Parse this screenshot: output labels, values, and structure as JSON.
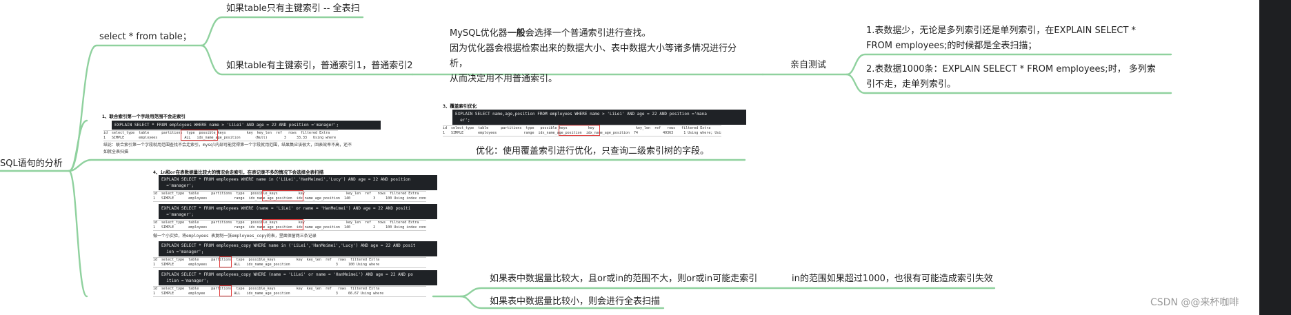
{
  "root": {
    "label": "SQL语句的分析"
  },
  "branch_select": {
    "label": "select * from table；",
    "children": [
      "如果table只有主键索引 -- 全表扫",
      "如果table有主键索引，普通索引1，普通索引2"
    ]
  },
  "optimizer": {
    "line1_prefix": "MySQL优化器",
    "line1_bold": "一般",
    "line1_suffix": "会选择一个普通索引进行查找。",
    "line2": "因为优化器会根据检索出来的数据大小、表中数据大小等诸多情况进行分析，",
    "line3": "从而决定用不用普通索引。"
  },
  "test": {
    "label": "亲自测试",
    "items": [
      "1.表数据少，无论是多列索引还是单列索引，在EXPLAIN SELECT * FROM employees;的时候都是全表扫描；",
      "2.表数据1000条：EXPLAIN SELECT * FROM employees;时，  多列索引不走，走单列索引。"
    ]
  },
  "snip1": {
    "heading": "1、联合索引第一个字段用范围不会走索引",
    "sql": "EXPLAIN SELECT * FROM employees WHERE name > 'LiLei' AND age = 22 AND position ='manager';",
    "table": "id  select_type  table      partitions  type  possible_keys          key  key_len  ref   rows  filtered Extra\n1   SIMPLE       employees             ALL   idx_name_age_position       (Null)        3     33.33   Using where",
    "conclusion1": "结论：联合索引第一个字段就用范围查找不会走索引，mysql内部可能觉得第一个字段就用范围，结果集应该很大，回表效率不高，还不",
    "conclusion2": "如就全表扫描"
  },
  "snip3": {
    "heading": "3、覆盖索引优化",
    "sql": "EXPLAIN SELECT name,age,position FROM employees WHERE name > 'LiLei' AND age = 22 AND position ='mana\n  er';",
    "table": "id  select_type  table      partitions  type   possible_keys          key                    key_len  ref   rows   filtered Extra\n1   SIMPLE       employees             range  idx_name_age_position  idx_name_age_position  74            49363     1 Using where; Using index",
    "caption": "优化：使用覆盖索引进行优化，只查询二级索引树的字段。"
  },
  "snip4": {
    "heading": "4、in和or在表数据量比较大的情况会走索引，在表记录不多的情况下会选择全表扫描",
    "sql1": "EXPLAIN SELECT * FROM employees WHERE name in ('LiLei','HanMeimei','Lucy') AND age = 22 AND position\n  ='manager';",
    "table1": "id  select_type  table      partitions  type   possible_keys          key                    key_len  ref   rows  filtered Extra\n1   SIMPLE       employees             range  idx_name_age_position  idx_name_age_position  140           3     100 Using index condition",
    "sql2": "EXPLAIN SELECT * FROM employees WHERE (name = 'LiLei' or name = 'HanMeimei') AND age = 22 AND positi\n  ='manager';",
    "table2": "id  select_type  table      partitions  type   possible_keys          key                    key_len  ref   rows  filtered Extra\n1   SIMPLE       employees             range  idx_name_age_position  idx_name_age_position  140           2     100 Using index condition",
    "note": "做一个小实验，将employees 表复制一张employees_copy的表，里面保留两三条记录",
    "sql3": "EXPLAIN SELECT * FROM employees_copy WHERE name in ('LiLei','HanMeimei','Lucy') AND age = 22 AND posit\n  ion ='manager';",
    "table3": "id  select_type  table      partitions  type  possible_keys          key  key_len  ref   rows  filtered Extra\n1   SIMPLE       employees             ALL   idx_name_age_position                      3     100 Using where",
    "sql4": "EXPLAIN SELECT * FROM employees_copy WHERE (name = 'LiLei' or name = 'HanMeimei') AND age = 22 AND po\n  ition ='manager';",
    "table4": "id  select_type  table      partitions  type  possible_keys          key  key_len  ref   rows  filtered Extra\n1   SIMPLE       employee              ALL   idx_name_age_position                      3     66.67 Using where"
  },
  "in_or": {
    "items": [
      "如果表中数据量比较大，且or或in的范围不大，则or或in可能走索引",
      "如果表中数据量比较小，则会进行全表扫描"
    ],
    "note": "in的范围如果超过1000，也很有可能造成索引失效"
  },
  "watermark": "CSDN @@来杯咖啡"
}
